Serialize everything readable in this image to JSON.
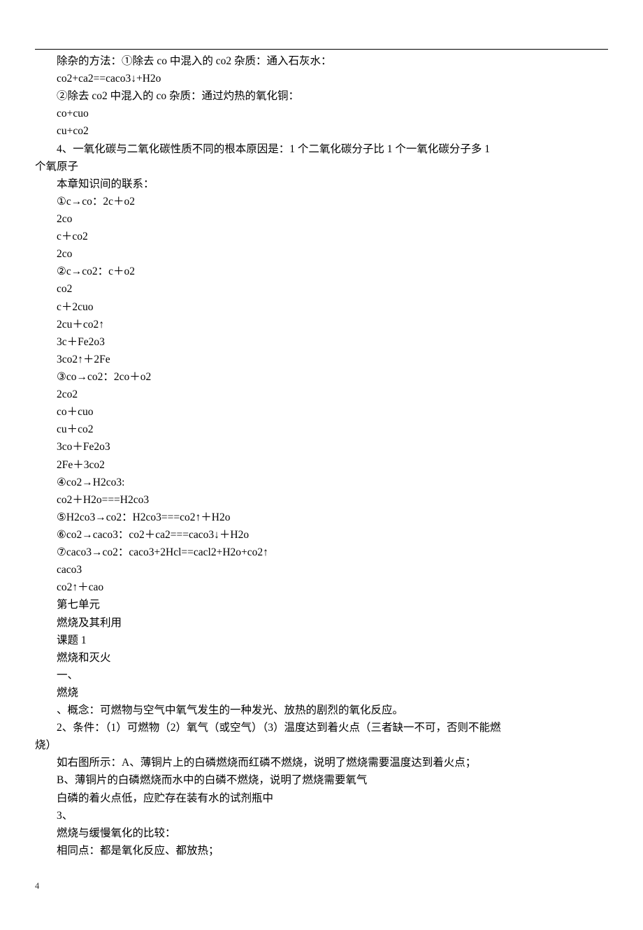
{
  "lines": [
    "除杂的方法：①除去 co 中混入的 co2 杂质：通入石灰水：",
    "co2+ca2==caco3↓+H2o",
    "②除去 co2 中混入的 co 杂质：通过灼热的氧化铜：",
    "co+cuo",
    "cu+co2",
    "4、一氧化碳与二氧化碳性质不同的根本原因是：1 个二氧化碳分子比 1 个一氧化碳分子多 1"
  ],
  "hanging": "个氧原子",
  "lines_rest": [
    "本章知识间的联系：",
    "①c→co：2c＋o2",
    "2co",
    "c＋co2",
    "2co",
    "②c→co2：c＋o2",
    "co2",
    "c＋2cuo",
    "2cu＋co2↑",
    "3c＋Fe2o3",
    "3co2↑＋2Fe",
    "③co→co2：2co＋o2",
    "2co2",
    "co＋cuo",
    "cu＋co2",
    "3co＋Fe2o3",
    "2Fe＋3co2",
    "④co2→H2co3:",
    "co2＋H2o===H2co3",
    "⑤H2co3→co2：H2co3===co2↑＋H2o",
    "⑥co2→caco3：co2＋ca2===caco3↓＋H2o",
    "⑦caco3→co2：caco3+2Hcl==cacl2+H2o+co2↑",
    "caco3",
    "co2↑＋cao",
    "第七单元",
    "燃烧及其利用",
    "课题 1",
    "燃烧和灭火",
    "一、",
    "燃烧",
    "、概念：可燃物与空气中氧气发生的一种发光、放热的剧烈的氧化反应。",
    "2、条件：（1）可燃物（2）氧气（或空气）（3）温度达到着火点（三者缺一不可，否则不能燃"
  ],
  "hanging2": "烧）",
  "lines_tail": [
    "如右图所示：A、薄铜片上的白磷燃烧而红磷不燃烧，说明了燃烧需要温度达到着火点；",
    "B、薄铜片的白磷燃烧而水中的白磷不燃烧，说明了燃烧需要氧气",
    "白磷的着火点低，应贮存在装有水的试剂瓶中",
    "3、",
    "燃烧与缓慢氧化的比较：",
    "相同点：都是氧化反应、都放热；"
  ],
  "page_number": "4"
}
